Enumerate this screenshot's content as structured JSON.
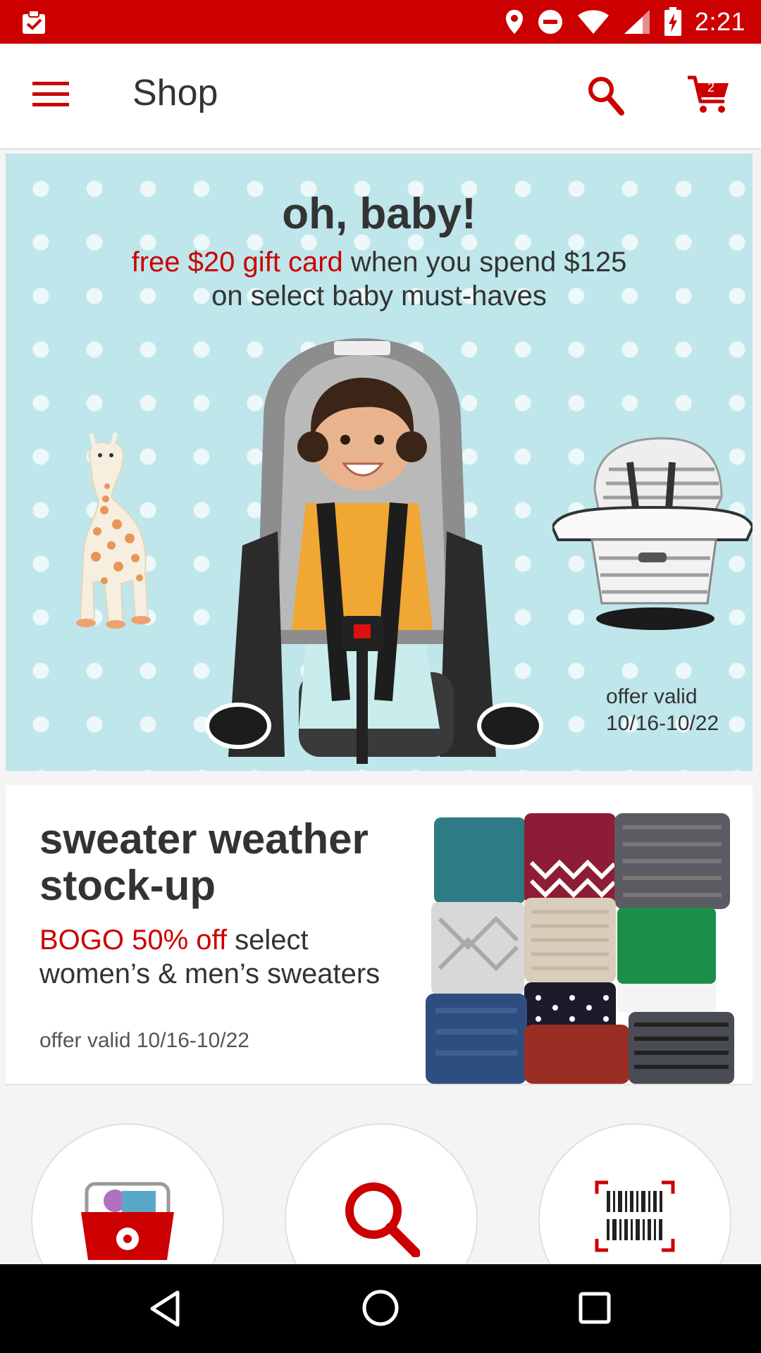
{
  "status_bar": {
    "time": "2:21",
    "icons": [
      "clipboard-check-icon",
      "location-icon",
      "do-not-disturb-icon",
      "wifi-icon",
      "cell-signal-icon",
      "battery-charging-icon"
    ]
  },
  "app_bar": {
    "title": "Shop",
    "cart_count": "2",
    "icons": [
      "menu-icon",
      "search-icon",
      "cart-icon"
    ]
  },
  "banner_baby": {
    "heading": "oh, baby!",
    "promo_red": "free $20 gift card",
    "promo_rest": " when you spend $125",
    "promo_line2": "on select baby must-haves",
    "offer_line1": "offer valid",
    "offer_line2": "10/16-10/22"
  },
  "banner_sweater": {
    "heading_line1": "sweater weather",
    "heading_line2": "stock-up",
    "promo_red": "BOGO 50% off",
    "promo_rest": " select",
    "promo_line2": "women’s & men’s sweaters",
    "offer": "offer valid 10/16-10/22"
  },
  "quick_actions": [
    "basket-icon",
    "search-icon",
    "barcode-scan-icon"
  ],
  "nav_bar": [
    "back-icon",
    "home-icon",
    "recents-icon"
  ],
  "colors": {
    "brand_red": "#cc0000",
    "banner_teal": "#bfe6ea",
    "text_dark": "#333333"
  }
}
